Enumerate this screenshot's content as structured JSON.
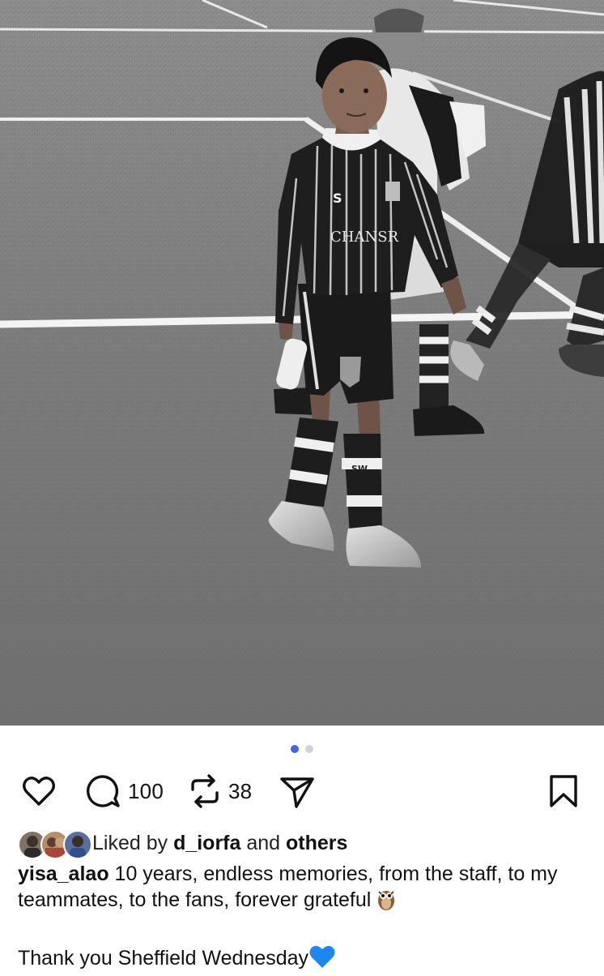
{
  "post": {
    "image_alt": "Black and white photo of a young footballer in a striped Sheffield Wednesday kit on a pitch",
    "carousel": {
      "total": 2,
      "current": 1
    },
    "kit_text": {
      "sponsor": "CHANSR",
      "sock": "SW"
    }
  },
  "actions": {
    "like_icon": "heart-icon",
    "comment_icon": "comment-icon",
    "comment_count": "100",
    "repost_icon": "repost-icon",
    "repost_count": "38",
    "share_icon": "send-icon",
    "save_icon": "bookmark-icon"
  },
  "likes": {
    "prefix": "Liked by ",
    "user": "d_iorfa",
    "middle": " and ",
    "others": "others"
  },
  "caption": {
    "username": "yisa_alao",
    "text": " 10 years, endless memories, from the staff, to my teammates, to the fans, forever grateful ",
    "emoji_1": "owl-emoji",
    "line2": "Thank you Sheffield Wednesday",
    "emoji_2": "blue-heart-emoji"
  },
  "colors": {
    "carousel_active": "#4a63e6",
    "carousel_inactive": "#cfd2d8",
    "blue_heart": "#1e86f0"
  }
}
